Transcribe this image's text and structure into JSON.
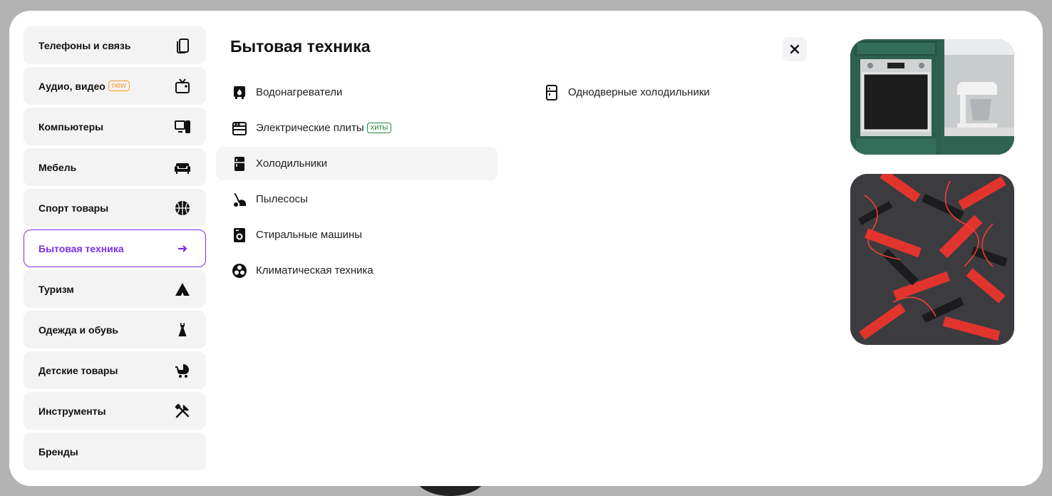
{
  "sidebar": {
    "items": [
      {
        "label": "Телефоны и связь",
        "icon": "phone-copy-icon"
      },
      {
        "label": "Аудио, видео",
        "badge": "new",
        "icon": "tv-icon"
      },
      {
        "label": "Компьютеры",
        "icon": "computer-icon"
      },
      {
        "label": "Мебель",
        "icon": "sofa-icon"
      },
      {
        "label": "Спорт товары",
        "icon": "basketball-icon"
      },
      {
        "label": "Бытовая техника",
        "icon": "arrow-right-icon",
        "active": true
      },
      {
        "label": "Туризм",
        "icon": "tent-icon"
      },
      {
        "label": "Одежда и обувь",
        "icon": "dress-icon"
      },
      {
        "label": "Детские товары",
        "icon": "stroller-icon"
      },
      {
        "label": "Инструменты",
        "icon": "tools-icon"
      },
      {
        "label": "Бренды"
      }
    ]
  },
  "main": {
    "title": "Бытовая техника",
    "columns": [
      [
        {
          "label": "Водонагреватели",
          "icon": "water-heater-icon"
        },
        {
          "label": "Электрические плиты",
          "badge": "хиты",
          "icon": "stove-icon"
        },
        {
          "label": "Холодильники",
          "icon": "fridge-icon"
        },
        {
          "label": "Пылесосы",
          "icon": "vacuum-icon"
        },
        {
          "label": "Стиральные машины",
          "icon": "washing-machine-icon"
        },
        {
          "label": "Климатическая техника",
          "icon": "fan-icon"
        }
      ],
      [
        {
          "label": "Однодверные холодильники",
          "icon": "single-door-fridge-icon"
        }
      ]
    ]
  },
  "colors": {
    "accent": "#7b2ff0",
    "badge_new": "#f0a030",
    "badge_hit": "#1f8a3a"
  }
}
